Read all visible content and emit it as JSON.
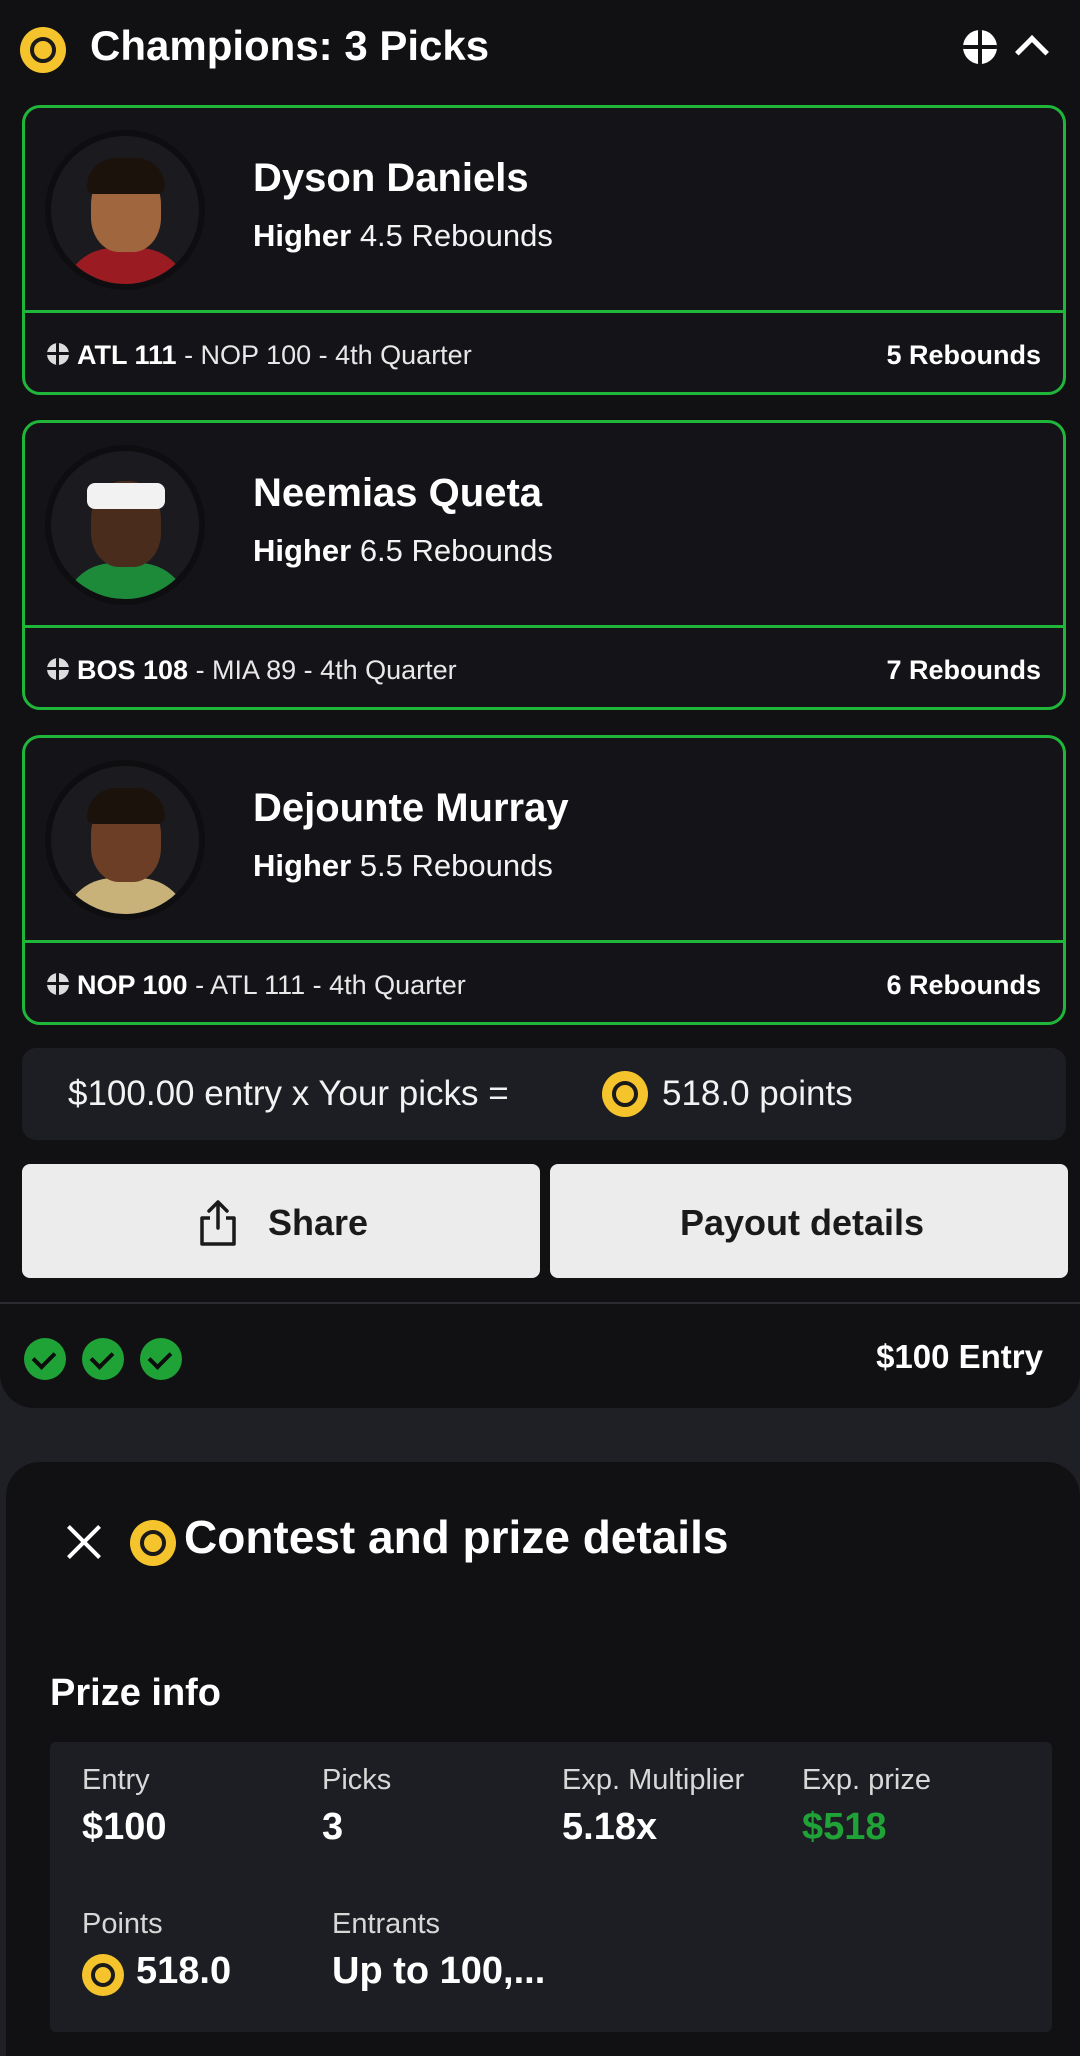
{
  "header": {
    "title": "Champions: 3 Picks"
  },
  "picks": [
    {
      "player": "Dyson Daniels",
      "direction": "Higher",
      "line": "4.5 Rebounds",
      "game_team": "ATL 111",
      "game_rest": " - NOP 100 - 4th Quarter",
      "result": "5 Rebounds",
      "colors": [
        "#d9262c",
        "#f5b01a",
        "#111114"
      ],
      "skin": "#a0673f",
      "jersey": "#9b1b22"
    },
    {
      "player": "Neemias Queta",
      "direction": "Higher",
      "line": "6.5 Rebounds",
      "game_team": "BOS 108",
      "game_rest": " - MIA 89 - 4th Quarter",
      "result": "7 Rebounds",
      "colors": [
        "#1d8a3a",
        "#f2f2f2",
        "#111114"
      ],
      "skin": "#4a2c1c",
      "jersey": "#1d8a3a"
    },
    {
      "player": "Dejounte Murray",
      "direction": "Higher",
      "line": "5.5 Rebounds",
      "game_team": "NOP 100",
      "game_rest": " - ATL 111 - 4th Quarter",
      "result": "6 Rebounds",
      "colors": [
        "#1d2a5e",
        "#d9262c",
        "#111114"
      ],
      "skin": "#6b3e25",
      "jersey": "#c8b27a"
    }
  ],
  "entry_summary": {
    "prefix": "$100.00 entry x Your picks =",
    "points": "518.0 points"
  },
  "buttons": {
    "share": "Share",
    "payout": "Payout details"
  },
  "footer": {
    "check_count": 3,
    "entry": "$100 Entry"
  },
  "sheet": {
    "title": "Contest and prize details",
    "prize_heading": "Prize info",
    "stats": {
      "entry_label": "Entry",
      "entry_value": "$100",
      "picks_label": "Picks",
      "picks_value": "3",
      "mult_label": "Exp. Multiplier",
      "mult_value": "5.18x",
      "prize_label": "Exp. prize",
      "prize_value": "$518",
      "points_label": "Points",
      "points_value": "518.0",
      "entrants_label": "Entrants",
      "entrants_value": "Up to 100,..."
    }
  },
  "colors": {
    "accent_green": "#1fb63a",
    "prize_green": "#1fa337",
    "medal_gold": "#f5c42c",
    "background": "#111114"
  },
  "icons": {
    "medal": "medal-icon",
    "basketball": "basketball-icon",
    "collapse": "chevron-up-icon",
    "share": "share-icon",
    "check": "check-circle-icon",
    "close": "close-icon"
  }
}
